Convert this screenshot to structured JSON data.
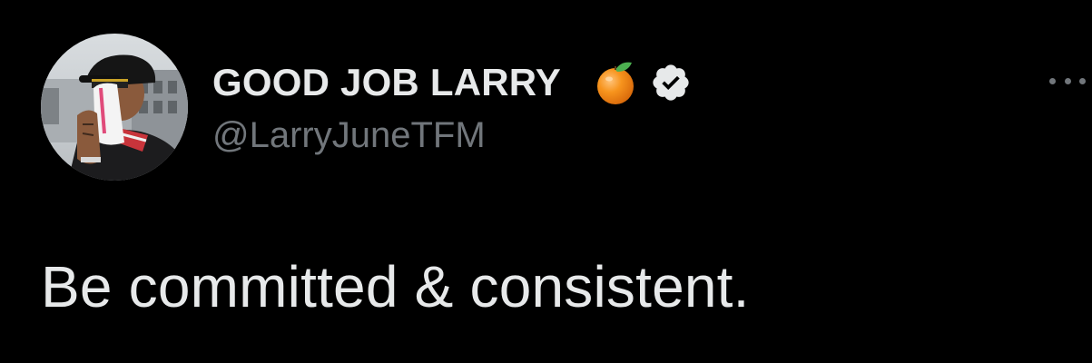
{
  "author": {
    "display_name": "GOOD JOB LARRY",
    "handle": "@LarryJuneTFM",
    "name_emoji": "orange-icon",
    "verified": true,
    "verified_icon": "verified-badge-icon"
  },
  "tweet": {
    "text": "Be committed & consistent."
  },
  "actions": {
    "more_icon": "more-options-icon"
  },
  "colors": {
    "background": "#000000",
    "primary_text": "#e7e9ea",
    "secondary_text": "#71767b"
  }
}
